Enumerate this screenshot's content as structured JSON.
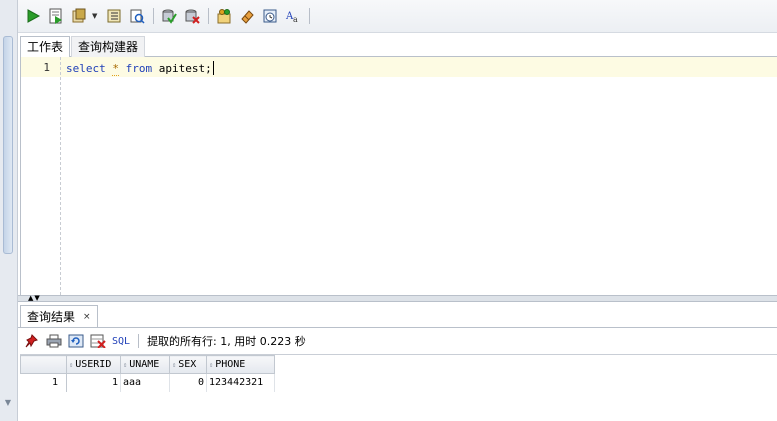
{
  "toolbar": {
    "buttons": [
      "run-statement",
      "run-script",
      "autotrace",
      "explain-plan",
      "sql-tuning",
      "commit",
      "rollback",
      "unshared-sql",
      "clear",
      "sql-history",
      "format"
    ]
  },
  "editor_tabs": [
    {
      "label": "工作表",
      "active": true
    },
    {
      "label": "查询构建器",
      "active": false
    }
  ],
  "editor": {
    "line_number": "1",
    "code": {
      "kw1": "select",
      "star": "*",
      "kw2": "from",
      "rest": "apitest;"
    }
  },
  "results": {
    "tab_label": "查询结果",
    "close_glyph": "×",
    "sql_label": "SQL",
    "status": "提取的所有行: 1, 用时 0.223 秒",
    "columns": [
      "USERID",
      "UNAME",
      "SEX",
      "PHONE"
    ],
    "rows": [
      {
        "num": "1",
        "cells": [
          "1",
          "aaa",
          "0",
          "123442321"
        ]
      }
    ]
  },
  "colors": {
    "keyword": "#1f3fb8",
    "current_line": "#fdfbe3",
    "run_green": "#2a9d2a"
  }
}
